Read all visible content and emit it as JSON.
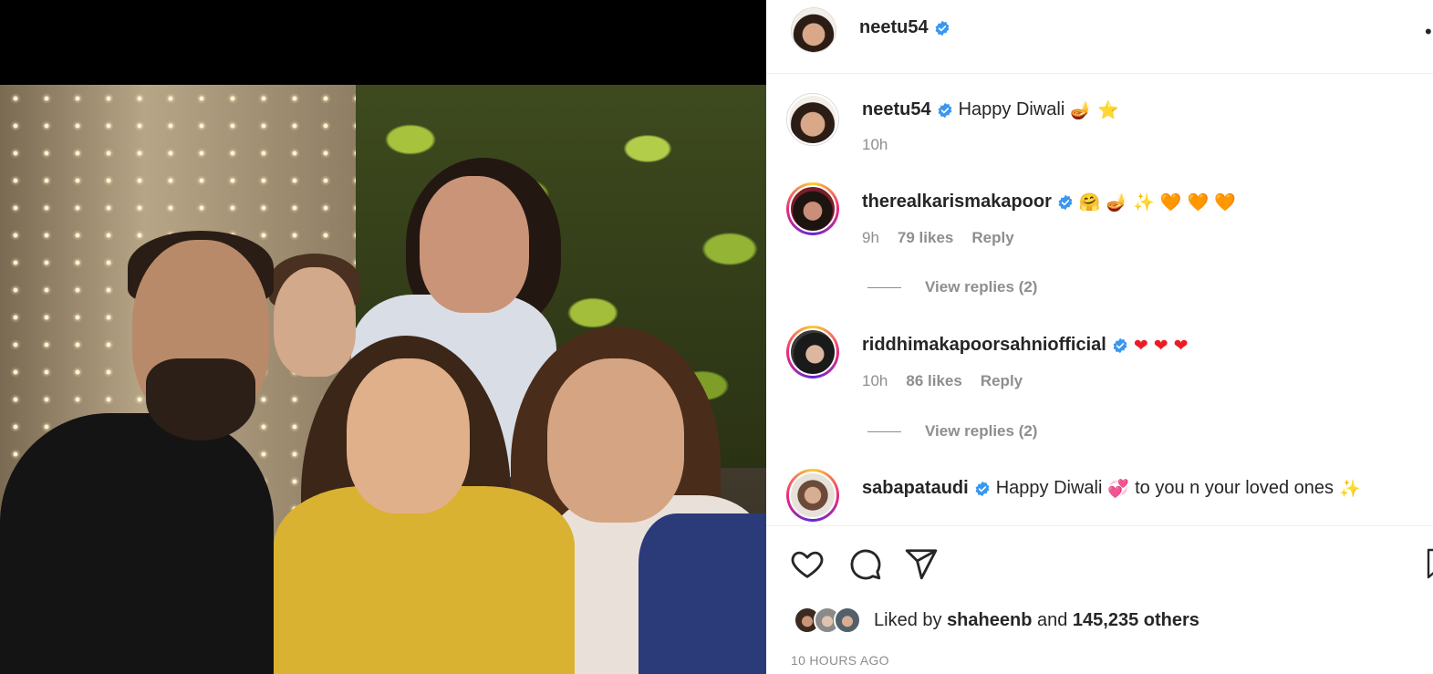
{
  "header": {
    "username": "neetu54"
  },
  "caption": {
    "username": "neetu54",
    "text": "Happy Diwali",
    "emojis": [
      "🪔",
      "⭐"
    ],
    "time": "10h"
  },
  "comments": [
    {
      "username": "therealkarismakapoor",
      "emojis": [
        "🤗",
        "🪔",
        "✨",
        "🧡",
        "🧡",
        "🧡"
      ],
      "time": "9h",
      "likes": "79 likes",
      "reply_label": "Reply",
      "view_replies": "View replies (2)"
    },
    {
      "username": "riddhimakapoorsahniofficial",
      "emojis": [
        "❤",
        "❤",
        "❤"
      ],
      "time": "10h",
      "likes": "86 likes",
      "reply_label": "Reply",
      "view_replies": "View replies (2)"
    },
    {
      "username": "sabapataudi",
      "text_before": "Happy Diwali",
      "emoji_mid": "💞",
      "text_after": "to you n your loved ones",
      "emoji_end": "✨"
    }
  ],
  "likes": {
    "prefix": "Liked by",
    "user": "shaheenb",
    "middle": "and",
    "count": "145,235 others"
  },
  "time_ago": "10 HOURS AGO"
}
